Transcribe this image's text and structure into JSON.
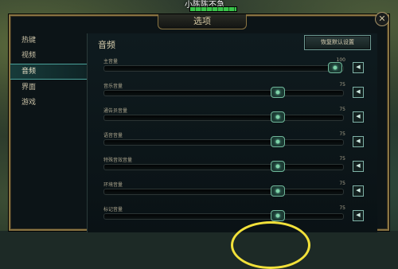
{
  "hud": {
    "champion_name": "小陈陈不急"
  },
  "dialog": {
    "title": "选项",
    "close_label": "✕"
  },
  "sidebar": {
    "items": [
      {
        "label": "热键",
        "active": false
      },
      {
        "label": "视频",
        "active": false
      },
      {
        "label": "音频",
        "active": true
      },
      {
        "label": "界面",
        "active": false
      },
      {
        "label": "游戏",
        "active": false
      }
    ]
  },
  "audio": {
    "title": "音频",
    "reset_label": "恢复默认设置",
    "sliders": [
      {
        "label": "主音量",
        "value": "100",
        "level": 1.0
      },
      {
        "label": "音乐音量",
        "value": "75",
        "level": 0.75
      },
      {
        "label": "通告员音量",
        "value": "75",
        "level": 0.75
      },
      {
        "label": "语音音量",
        "value": "75",
        "level": 0.75
      },
      {
        "label": "特殊音效音量",
        "value": "75",
        "level": 0.75
      },
      {
        "label": "环境音量",
        "value": "75",
        "level": 0.75
      },
      {
        "label": "标记音量",
        "value": "75",
        "level": 0.75
      }
    ]
  },
  "icons": {
    "mute": "speaker-icon",
    "close": "close-icon"
  },
  "colors": {
    "accent": "#4aa19a",
    "frame": "#8a7543",
    "text": "#d9cfae"
  }
}
